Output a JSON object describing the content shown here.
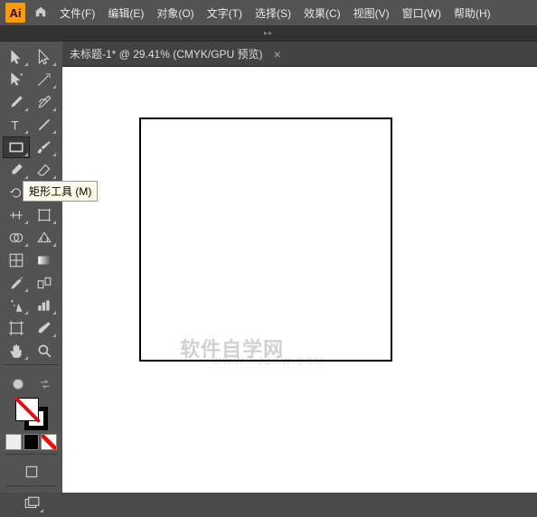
{
  "app": {
    "logo": "Ai"
  },
  "menu": [
    "文件(F)",
    "编辑(E)",
    "对象(O)",
    "文字(T)",
    "选择(S)",
    "效果(C)",
    "视图(V)",
    "窗口(W)",
    "帮助(H)"
  ],
  "tab": {
    "title": "未标题-1* @ 29.41% (CMYK/GPU 预览)"
  },
  "tooltip": "矩形工具 (M)",
  "watermark": {
    "main": "软件自学网",
    "sub": "WWW.RJZXW.COM"
  },
  "tools": {
    "rows": [
      [
        "selection",
        "direct-selection"
      ],
      [
        "group-selection",
        "magic-wand"
      ],
      [
        "pen",
        "curvature"
      ],
      [
        "type",
        "line"
      ],
      [
        "rectangle",
        "brush"
      ],
      [
        "shaper",
        "eraser"
      ],
      [
        "rotate",
        "scale"
      ],
      [
        "width",
        "free-transform"
      ],
      [
        "shape-builder",
        "perspective"
      ],
      [
        "mesh",
        "gradient"
      ],
      [
        "eyedropper",
        "blend"
      ],
      [
        "symbol-sprayer",
        "graph"
      ],
      [
        "artboard",
        "slice"
      ],
      [
        "hand",
        "zoom"
      ]
    ]
  }
}
